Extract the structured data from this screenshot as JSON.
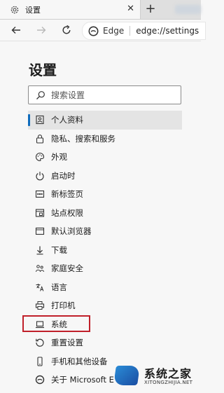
{
  "browser": {
    "tab": {
      "title": "设置",
      "icon": "gear-icon",
      "close_label": "✕"
    },
    "new_tab_label": "+",
    "toolbar": {
      "back_icon": "arrow-left-icon",
      "forward_icon": "arrow-right-icon",
      "refresh_icon": "refresh-icon",
      "site_name": "Edge",
      "url": "edge://settings"
    }
  },
  "settings": {
    "title": "设置",
    "search": {
      "placeholder": "搜索设置",
      "value": ""
    },
    "menu": [
      {
        "label": "个人资料",
        "icon": "profile-icon",
        "active": true
      },
      {
        "label": "隐私、搜索和服务",
        "icon": "lock-icon"
      },
      {
        "label": "外观",
        "icon": "palette-icon"
      },
      {
        "label": "启动时",
        "icon": "power-icon"
      },
      {
        "label": "新标签页",
        "icon": "new-tab-page-icon"
      },
      {
        "label": "站点权限",
        "icon": "site-permissions-icon"
      },
      {
        "label": "默认浏览器",
        "icon": "browser-window-icon"
      },
      {
        "label": "下载",
        "icon": "download-icon"
      },
      {
        "label": "家庭安全",
        "icon": "family-icon"
      },
      {
        "label": "语言",
        "icon": "language-icon"
      },
      {
        "label": "打印机",
        "icon": "printer-icon"
      },
      {
        "label": "系统",
        "icon": "laptop-icon",
        "highlighted": true
      },
      {
        "label": "重置设置",
        "icon": "reset-icon"
      },
      {
        "label": "手机和其他设备",
        "icon": "phone-icon"
      },
      {
        "label": "关于 Microsoft E",
        "icon": "edge-logo-icon"
      }
    ]
  },
  "watermark": {
    "text": "系统之家",
    "subtext": "XITONGZHIJIA.NET"
  },
  "colors": {
    "accent": "#0f6cbd",
    "highlight_box": "#c0202a"
  }
}
